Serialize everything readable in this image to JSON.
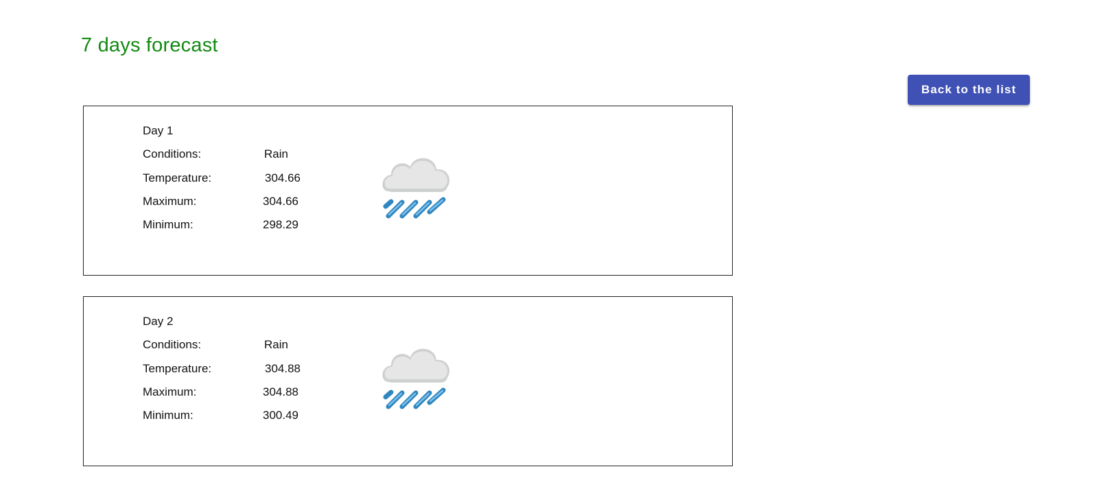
{
  "header": {
    "title": "7 days forecast",
    "back_button_label": "Back to the list"
  },
  "colors": {
    "title": "#128a12",
    "button_bg": "#3f51b5",
    "cloud": "#e6e6e6",
    "rain": "#2f86c0"
  },
  "labels": {
    "conditions": "Conditions:",
    "temperature": "Temperature:",
    "maximum": "Maximum:",
    "minimum": "Minimum:"
  },
  "days": [
    {
      "label": "Day 1",
      "conditions": "Rain",
      "temperature": "304.66",
      "maximum": "304.66",
      "minimum": "298.29",
      "icon": "rain-cloud-icon"
    },
    {
      "label": "Day 2",
      "conditions": "Rain",
      "temperature": "304.88",
      "maximum": "304.88",
      "minimum": "300.49",
      "icon": "rain-cloud-icon"
    }
  ]
}
